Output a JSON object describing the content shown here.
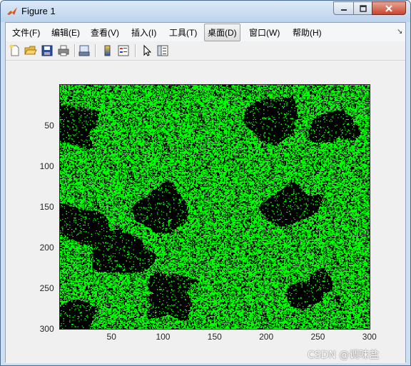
{
  "window": {
    "title": "Figure 1",
    "controls": {
      "minimize": "minimize",
      "maximize": "maximize",
      "close": "close"
    }
  },
  "menu": {
    "items": [
      {
        "label": "文件(F)"
      },
      {
        "label": "编辑(E)"
      },
      {
        "label": "查看(V)"
      },
      {
        "label": "插入(I)"
      },
      {
        "label": "工具(T)"
      },
      {
        "label": "桌面(D)"
      },
      {
        "label": "窗口(W)"
      },
      {
        "label": "帮助(H)"
      }
    ],
    "active_index": 5
  },
  "toolbar": {
    "icons": [
      "new-file-icon",
      "open-folder-icon",
      "save-icon",
      "print-icon",
      "print-preview-icon",
      "colorbar-icon",
      "legend-icon",
      "pointer-icon",
      "property-editor-icon"
    ]
  },
  "chart_data": {
    "type": "heatmap",
    "title": "",
    "xlabel": "",
    "ylabel": "",
    "xlim": [
      0,
      300
    ],
    "ylim": [
      0,
      300
    ],
    "y_direction": "reverse",
    "x_ticks": [
      50,
      100,
      150,
      200,
      250,
      300
    ],
    "y_ticks": [
      50,
      100,
      150,
      200,
      250,
      300
    ],
    "x_tick_labels": [
      "50",
      "100",
      "150",
      "200",
      "250",
      "300"
    ],
    "y_tick_labels": [
      "50",
      "100",
      "150",
      "200",
      "250",
      "300"
    ],
    "colors": {
      "background": "#000000",
      "foreground": "#00ff00",
      "accent": "#c0392b"
    },
    "dark_region_centers": [
      {
        "x": 15,
        "y": 50
      },
      {
        "x": 265,
        "y": 50
      },
      {
        "x": 200,
        "y": 40
      },
      {
        "x": 100,
        "y": 150
      },
      {
        "x": 225,
        "y": 150
      },
      {
        "x": 60,
        "y": 205
      },
      {
        "x": 105,
        "y": 260
      },
      {
        "x": 240,
        "y": 255
      },
      {
        "x": 15,
        "y": 280
      },
      {
        "x": 20,
        "y": 170
      }
    ]
  },
  "watermark": {
    "text": "CSDN @调味盐"
  }
}
